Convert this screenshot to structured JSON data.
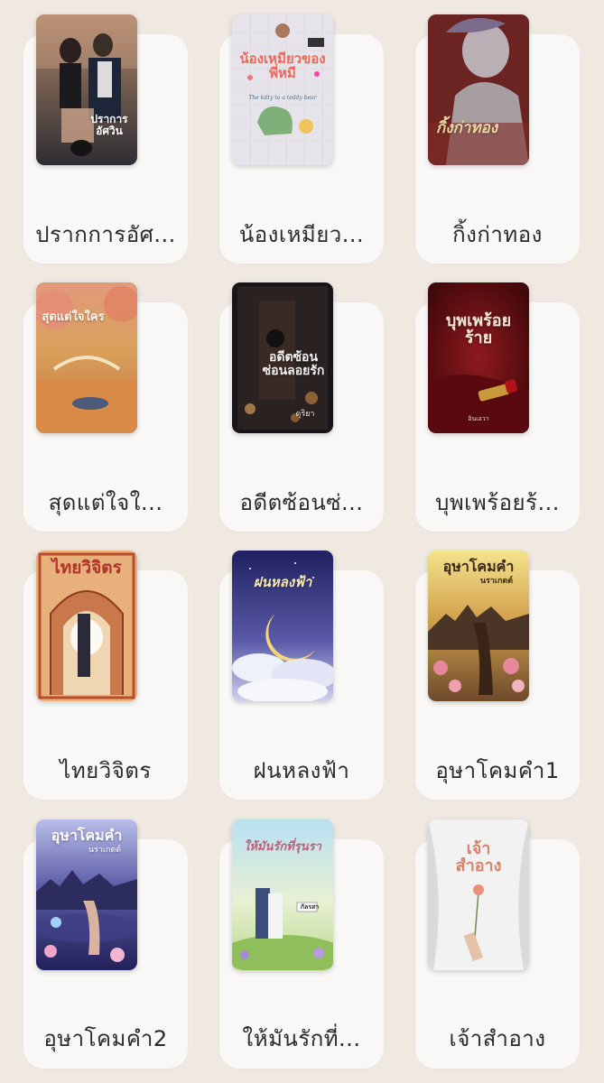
{
  "books": [
    {
      "title": "ปรากการอัศ...",
      "cover_title": "ปราการอัศวิน",
      "cover_colors": [
        "#8a6a55",
        "#3a3a44"
      ]
    },
    {
      "title": "น้องเหมียว...",
      "cover_title": "น้องเหมียวของพี่หมี",
      "cover_subtitle": "The kitty to a teddy bear",
      "cover_colors": [
        "#e9e6ea",
        "#d5d9df"
      ]
    },
    {
      "title": "กิ้งก่าทอง",
      "cover_title": "กิ้งก่าทอง",
      "cover_colors": [
        "#7a2a2a",
        "#5b1c1c"
      ]
    },
    {
      "title": "สุดแต่ใจใ...",
      "cover_title": "สุดแต่ใจใคร",
      "cover_colors": [
        "#d98c5a",
        "#e2b160"
      ]
    },
    {
      "title": "อดีตซ้อนซ่...",
      "cover_title": "อดีตซ้อนซ่อนลอยรัก",
      "cover_author": "ดุริยา",
      "cover_colors": [
        "#1f1a1a",
        "#5a3a22"
      ]
    },
    {
      "title": "บุพเพร้อยร้...",
      "cover_title": "บุพเพร้อยร้าย",
      "cover_author": "อินเอวา",
      "cover_colors": [
        "#6e0f14",
        "#3a0608"
      ]
    },
    {
      "title": "ไทยวิจิตร",
      "cover_title": "ไทยวิจิตร",
      "cover_colors": [
        "#e7b27a",
        "#c9683d"
      ]
    },
    {
      "title": "ฝนหลงฟ้า",
      "cover_title": "ฝนหลงฟ้า",
      "cover_colors": [
        "#2a2c6a",
        "#8c87c4"
      ]
    },
    {
      "title": "อุษาโคมคำ1",
      "cover_title": "อุษาโคมคำ",
      "cover_author": "นราเกตต์",
      "cover_colors": [
        "#f1dd8a",
        "#8c5f2b"
      ]
    },
    {
      "title": "อุษาโคมคำ2",
      "cover_title": "อุษาโคมคำ",
      "cover_author": "นราเกตต์",
      "cover_colors": [
        "#a4a9de",
        "#2b2b6e"
      ]
    },
    {
      "title": "ให้มันรักที่...",
      "cover_title": "ให้มันรักที่รุนรา",
      "cover_author": "กัลรสา",
      "cover_colors": [
        "#bde0f0",
        "#d4e6a8"
      ]
    },
    {
      "title": "เจ้าสำอาง",
      "cover_title": "เจ้าสำอาง",
      "cover_colors": [
        "#f4f4f4",
        "#dcdcdc"
      ]
    }
  ]
}
